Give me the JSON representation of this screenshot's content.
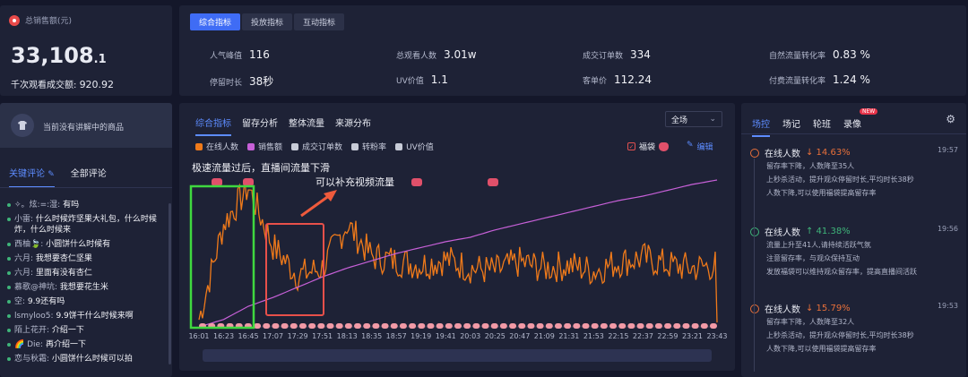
{
  "sales": {
    "label": "总销售额(元)",
    "value_main": "33,108",
    "value_dec": ".1",
    "per_thousand_label": "千次观看成交额:",
    "per_thousand_value": "920.92"
  },
  "metrics": {
    "tabs": [
      "综合指标",
      "投放指标",
      "互动指标"
    ],
    "items": [
      {
        "label": "人气峰值",
        "value": "116"
      },
      {
        "label": "总观看人数",
        "value": "3.01w"
      },
      {
        "label": "成交订单数",
        "value": "334"
      },
      {
        "label": "自然流量转化率",
        "value": "0.83 %"
      },
      {
        "label": "停留时长",
        "value": "38秒"
      },
      {
        "label": "UV价值",
        "value": "1.1"
      },
      {
        "label": "客单价",
        "value": "112.24"
      },
      {
        "label": "付费流量转化率",
        "value": "1.24 %"
      }
    ]
  },
  "product": {
    "empty_text": "当前没有讲解中的商品"
  },
  "comments": {
    "tabs": [
      "关键评论",
      "全部评论"
    ],
    "items": [
      {
        "user": "✧。炫:=:湿:",
        "text": "有吗"
      },
      {
        "user": "小雷:",
        "text": "什么时候炸坚果大礼包，什么时候炸，什么时候来"
      },
      {
        "user": "西柚🍃:",
        "text": "小圆饼什么时候有"
      },
      {
        "user": "六月:",
        "text": "我想要杏仁坚果"
      },
      {
        "user": "六月:",
        "text": "里面有没有杏仁"
      },
      {
        "user": "慕歌@神坑:",
        "text": "我想要花生米"
      },
      {
        "user": "空:",
        "text": "9.9还有吗"
      },
      {
        "user": "lsmyloo5:",
        "text": "9.9饼干什么时候来啊"
      },
      {
        "user": "陌上花开:",
        "text": "介绍一下"
      },
      {
        "user": "🌈 Die:",
        "text": "再介绍一下"
      },
      {
        "user": "恋与秋霜:",
        "text": "小圆饼什么时候可以拍"
      }
    ]
  },
  "chart_panel": {
    "tabs": [
      "综合指标",
      "留存分析",
      "整体流量",
      "来源分布"
    ],
    "select_value": "全场",
    "legend": [
      {
        "name": "在线人数",
        "color": "#f07a1a",
        "checked": true
      },
      {
        "name": "销售额",
        "color": "#c760d8",
        "checked": true
      },
      {
        "name": "成交订单数",
        "color": "#c8ccd8",
        "checked": false
      },
      {
        "name": "转粉率",
        "color": "#c8ccd8",
        "checked": false
      },
      {
        "name": "UV价值",
        "color": "#c8ccd8",
        "checked": false
      }
    ],
    "fudai_label": "福袋",
    "edit_label": "编辑",
    "annotation_1": "极速流量过后，直播间流量下滑",
    "annotation_2": "可以补充视频流量"
  },
  "chart_data": {
    "type": "line",
    "x": [
      "16:01",
      "16:23",
      "16:45",
      "17:07",
      "17:29",
      "17:51",
      "18:13",
      "18:35",
      "18:57",
      "19:19",
      "19:41",
      "20:03",
      "20:25",
      "20:47",
      "21:09",
      "21:31",
      "21:53",
      "22:15",
      "22:37",
      "22:59",
      "23:21",
      "23:43"
    ],
    "series": [
      {
        "name": "在线人数",
        "color": "#f07a1a",
        "values": [
          5,
          70,
          95,
          55,
          35,
          40,
          70,
          48,
          45,
          42,
          46,
          40,
          38,
          44,
          40,
          42,
          38,
          44,
          47,
          42,
          40,
          42
        ]
      },
      {
        "name": "销售额",
        "color": "#c760d8",
        "values": [
          0,
          5,
          14,
          20,
          27,
          34,
          40,
          45,
          50,
          54,
          58,
          61,
          66,
          70,
          74,
          78,
          82,
          86,
          89,
          93,
          97,
          100
        ]
      }
    ]
  },
  "side": {
    "tabs": [
      "场控",
      "场记",
      "轮班",
      "录像"
    ],
    "new_badge": "NEW",
    "events": [
      {
        "title": "在线人数",
        "direction": "down",
        "change": "↓ 14.63%",
        "time": "19:57",
        "lines": [
          "留存率下降，人数降至35人",
          "上秒杀活动，提升观众停留时长,平均时长38秒",
          "人数下降,可以使用福袋提高留存率"
        ]
      },
      {
        "title": "在线人数",
        "direction": "up",
        "change": "↑ 41.38%",
        "time": "19:56",
        "lines": [
          "流量上升至41人,请持续活跃气氛",
          "注意留存率，与观众保持互动",
          "发放福袋可以维持观众留存率，提高直播间活跃"
        ]
      },
      {
        "title": "在线人数",
        "direction": "down",
        "change": "↓ 15.79%",
        "time": "19:53",
        "lines": [
          "留存率下降，人数降至32人",
          "上秒杀活动，提升观众停留时长,平均时长38秒",
          "人数下降,可以使用福袋提高留存率"
        ]
      }
    ]
  }
}
